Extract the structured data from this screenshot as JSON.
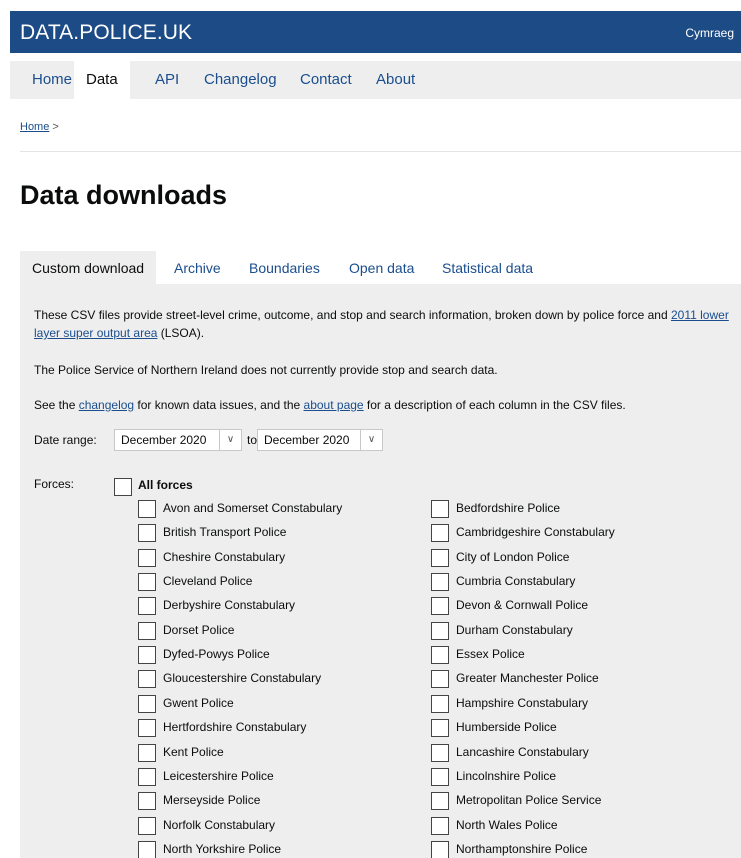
{
  "header": {
    "brand": "DATA.POLICE.UK",
    "language_link": "Cymraeg"
  },
  "nav": {
    "items": [
      "Home",
      "Data",
      "API",
      "Changelog",
      "Contact",
      "About"
    ],
    "active": "Data"
  },
  "breadcrumb": {
    "home": "Home",
    "separator": ">"
  },
  "page": {
    "title": "Data downloads"
  },
  "tabs": {
    "items": [
      "Custom download",
      "Archive",
      "Boundaries",
      "Open data",
      "Statistical data"
    ],
    "active": "Custom download"
  },
  "custom_download": {
    "intro_prefix": "These CSV files provide street-level crime, outcome, and stop and search information, broken down by police force and ",
    "intro_link": "2011 lower layer super output area",
    "intro_suffix": " (LSOA).",
    "psni_note": "The Police Service of Northern Ireland does not currently provide stop and search data.",
    "see_prefix": "See the ",
    "changelog_link": "changelog",
    "see_middle": " for known data issues, and the ",
    "about_link": "about page",
    "see_suffix": " for a description of each column in the CSV files.",
    "date_range_label": "Date range:",
    "date_from": "December 2020",
    "date_to_word": "to",
    "date_to": "December 2020",
    "forces_label": "Forces:",
    "all_forces_label": "All forces",
    "forces_left": [
      "Avon and Somerset Constabulary",
      "British Transport Police",
      "Cheshire Constabulary",
      "Cleveland Police",
      "Derbyshire Constabulary",
      "Dorset Police",
      "Dyfed-Powys Police",
      "Gloucestershire Constabulary",
      "Gwent Police",
      "Hertfordshire Constabulary",
      "Kent Police",
      "Leicestershire Police",
      "Merseyside Police",
      "Norfolk Constabulary",
      "North Yorkshire Police"
    ],
    "forces_right": [
      "Bedfordshire Police",
      "Cambridgeshire Constabulary",
      "City of London Police",
      "Cumbria Constabulary",
      "Devon & Cornwall Police",
      "Durham Constabulary",
      "Essex Police",
      "Greater Manchester Police",
      "Hampshire Constabulary",
      "Humberside Police",
      "Lancashire Constabulary",
      "Lincolnshire Police",
      "Metropolitan Police Service",
      "North Wales Police",
      "Northamptonshire Police"
    ]
  },
  "colors": {
    "header_bg": "#1d4b85",
    "link": "#1a4e8e",
    "panel_bg": "#eeeeee"
  }
}
